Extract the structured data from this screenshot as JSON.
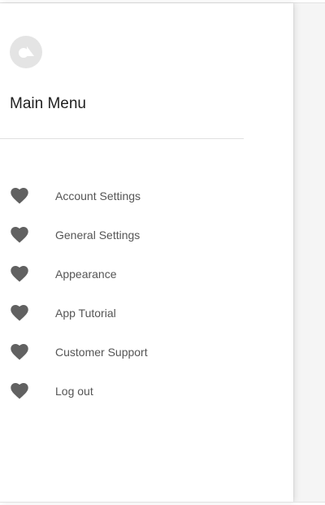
{
  "drawer": {
    "title": "Main Menu",
    "logo_icon": "app-logo-icon",
    "menu_items": [
      {
        "label": "Account Settings",
        "icon": "heart-icon"
      },
      {
        "label": "General Settings",
        "icon": "heart-icon"
      },
      {
        "label": "Appearance",
        "icon": "heart-icon"
      },
      {
        "label": "App Tutorial",
        "icon": "heart-icon"
      },
      {
        "label": "Customer Support",
        "icon": "heart-icon"
      },
      {
        "label": "Log out",
        "icon": "heart-icon"
      }
    ]
  },
  "colors": {
    "icon": "#616161",
    "label": "#555555",
    "title": "#212121",
    "backdrop": "#f5f5f5"
  }
}
